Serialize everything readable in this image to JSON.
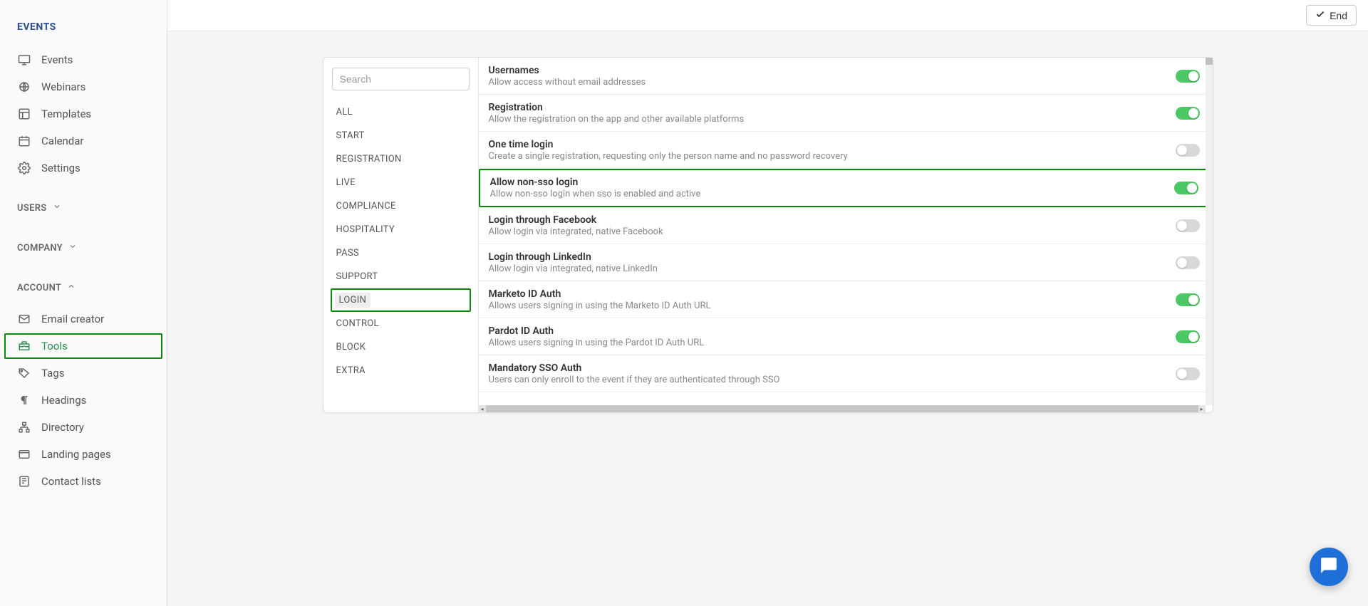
{
  "sidebar": {
    "header": "EVENTS",
    "events_nav": [
      {
        "label": "Events",
        "icon": "monitor"
      },
      {
        "label": "Webinars",
        "icon": "globe"
      },
      {
        "label": "Templates",
        "icon": "template"
      },
      {
        "label": "Calendar",
        "icon": "calendar"
      },
      {
        "label": "Settings",
        "icon": "gear"
      }
    ],
    "section_users": "USERS",
    "section_company": "COMPANY",
    "section_account": "ACCOUNT",
    "account_nav": [
      {
        "label": "Email creator",
        "icon": "mail"
      },
      {
        "label": "Tools",
        "icon": "toolbox",
        "active": true,
        "highlighted": true
      },
      {
        "label": "Tags",
        "icon": "tag"
      },
      {
        "label": "Headings",
        "icon": "pilcrow"
      },
      {
        "label": "Directory",
        "icon": "sitemap"
      },
      {
        "label": "Landing pages",
        "icon": "window"
      },
      {
        "label": "Contact lists",
        "icon": "phone"
      }
    ]
  },
  "topbar": {
    "end_label": "End"
  },
  "filter": {
    "search_placeholder": "Search",
    "categories": [
      "ALL",
      "START",
      "REGISTRATION",
      "LIVE",
      "COMPLIANCE",
      "HOSPITALITY",
      "PASS",
      "SUPPORT",
      "LOGIN",
      "CONTROL",
      "BLOCK",
      "EXTRA"
    ],
    "active_index": 8
  },
  "settings": [
    {
      "title": "Usernames",
      "desc": "Allow access without email addresses",
      "on": true
    },
    {
      "title": "Registration",
      "desc": "Allow the registration on the app and other available platforms",
      "on": true
    },
    {
      "title": "One time login",
      "desc": "Create a single registration, requesting only the person name and no password recovery",
      "on": false
    },
    {
      "title": "Allow non-sso login",
      "desc": "Allow non-sso login when sso is enabled and active",
      "on": true,
      "highlighted": true
    },
    {
      "title": "Login through Facebook",
      "desc": "Allow login via integrated, native Facebook",
      "on": false
    },
    {
      "title": "Login through LinkedIn",
      "desc": "Allow login via integrated, native LinkedIn",
      "on": false
    },
    {
      "title": "Marketo ID Auth",
      "desc": "Allows users signing in using the Marketo ID Auth URL",
      "on": true
    },
    {
      "title": "Pardot ID Auth",
      "desc": "Allows users signing in using the Pardot ID Auth URL",
      "on": true
    },
    {
      "title": "Mandatory SSO Auth",
      "desc": "Users can only enroll to the event if they are authenticated through SSO",
      "on": false
    }
  ]
}
